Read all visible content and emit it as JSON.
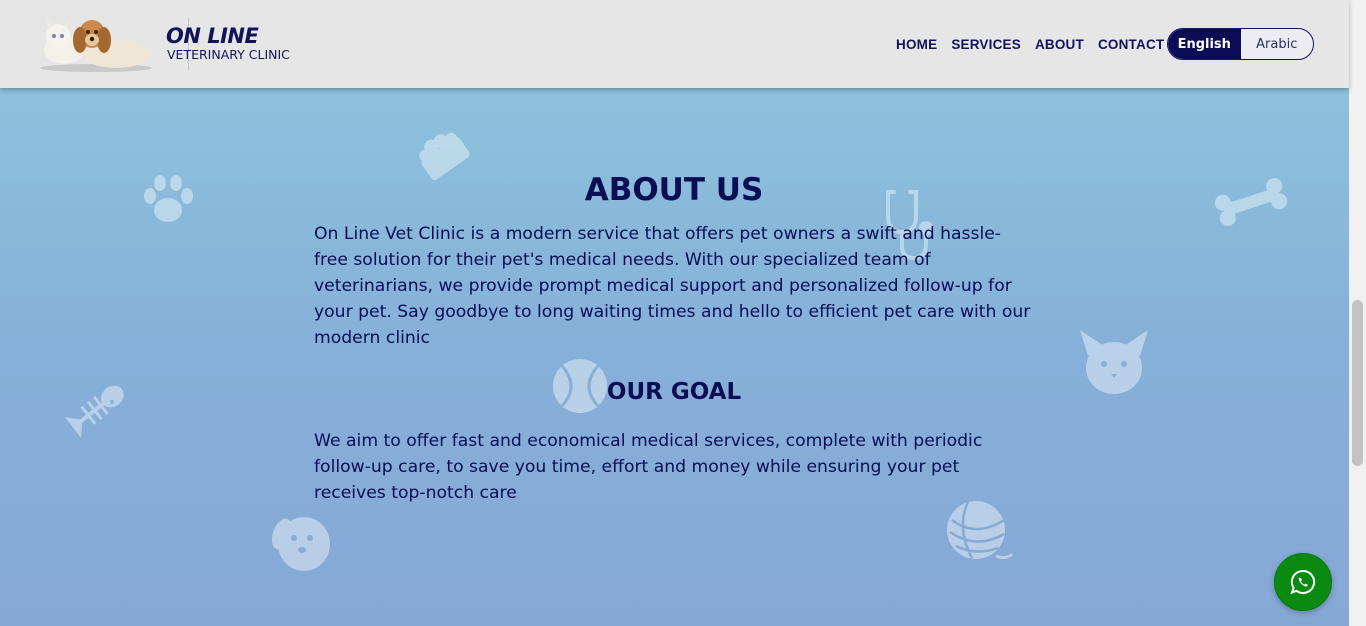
{
  "header": {
    "logo_title": "ON LINE",
    "logo_subtitle": "VETERINARY CLINIC",
    "nav": [
      "HOME",
      "SERVICES",
      "ABOUT",
      "CONTACT"
    ],
    "languages": {
      "active": "English",
      "inactive": "Arabic"
    }
  },
  "about": {
    "title": "ABOUT US",
    "text": "On Line Vet Clinic is a modern service that offers pet owners a swift and hassle-free solution for their pet's medical needs. With our specialized team of veterinarians, we provide prompt medical support and personalized follow-up for your pet. Say goodbye to long waiting times and hello to efficient pet care with our modern clinic"
  },
  "goal": {
    "title": "OUR GOAL",
    "text": "We aim to offer fast and economical medical services, complete with periodic follow-up care, to save you time, effort and money while ensuring your pet receives top-notch care"
  },
  "decor_icons": [
    "food-bowl-icon",
    "paw-icon",
    "stethoscope-icon",
    "bone-icon",
    "fish-bone-icon",
    "ball-icon",
    "cat-icon",
    "dog-icon",
    "yarn-ball-icon"
  ],
  "floating": {
    "icon": "whatsapp-icon"
  },
  "colors": {
    "brand_navy": "#0c0d55",
    "header_bg": "#e6e6e6",
    "whatsapp_green": "#0a8a10",
    "bg_top": "#8ec8dd",
    "bg_bottom": "#86a8d6"
  }
}
